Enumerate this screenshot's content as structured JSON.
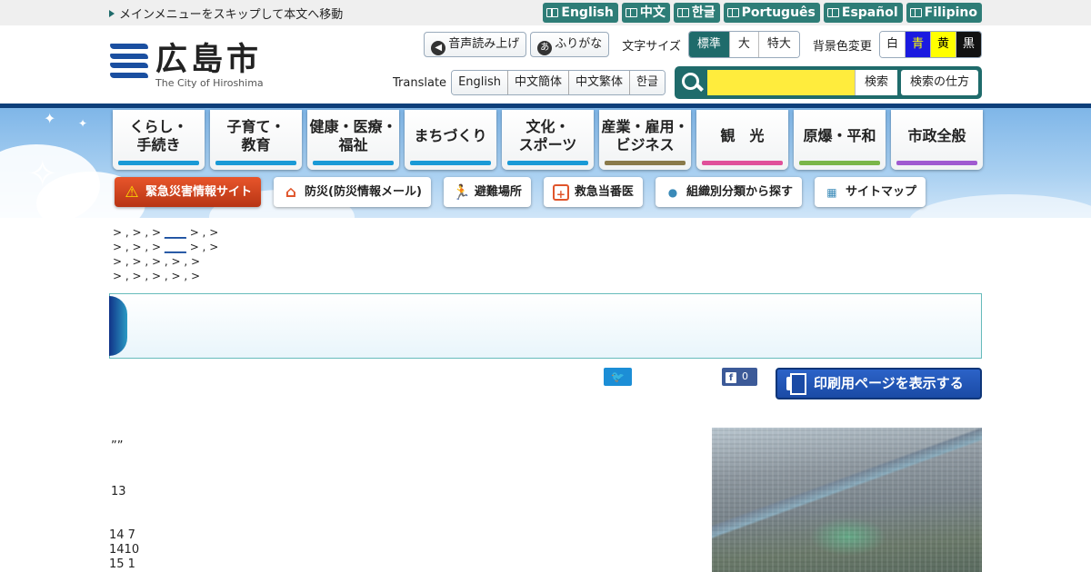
{
  "topbar": {
    "skip_link": "メインメニューをスキップして本文へ移動",
    "languages": [
      "English",
      "中文",
      "한글",
      "Português",
      "Español",
      "Filipino"
    ]
  },
  "logo": {
    "jp": "広島市",
    "en": "The City of Hiroshima"
  },
  "tools": {
    "voice_label": "音声読み上げ",
    "furigana_label": "ふりがな",
    "furigana_icon_glyph": "あ",
    "fontsize_label": "文字サイズ",
    "fontsize_options": [
      "標準",
      "大",
      "特大"
    ],
    "fontsize_selected": "標準",
    "bgcolor_label": "背景色変更",
    "bgcolor_options": [
      "白",
      "青",
      "黄",
      "黒"
    ],
    "translate_label": "Translate",
    "translate_options": [
      "English",
      "中文簡体",
      "中文繁体",
      "한글"
    ],
    "search_button": "検索",
    "search_help_button": "検索の仕方"
  },
  "nav": [
    {
      "label": "くらし・\n手続き",
      "color": "#1a9ad6"
    },
    {
      "label": "子育て・\n教育",
      "color": "#1a9ad6"
    },
    {
      "label": "健康・医療・\n福祉",
      "color": "#1a9ad6"
    },
    {
      "label": "まちづくり",
      "color": "#1a9ad6"
    },
    {
      "label": "文化・\nスポーツ",
      "color": "#1a9ad6"
    },
    {
      "label": "産業・雇用・\nビジネス",
      "color": "#8a7a4a"
    },
    {
      "label": "観　光",
      "color": "#e0509a"
    },
    {
      "label": "原爆・平和",
      "color": "#7ab648"
    },
    {
      "label": "市政全般",
      "color": "#a05ad0"
    }
  ],
  "quick": {
    "emergency": "緊急災害情報サイト",
    "bousai": "防災(防災情報メール)",
    "hinan": "避難場所",
    "kyuukyuu": "救急当番医",
    "soshiki": "組織別分類から探す",
    "sitemap": "サイトマップ"
  },
  "breadcrumbs": {
    "line1": "> , > , > ",
    "line1_link": "____",
    "line1_tail": " > , >",
    "line2": "> , > , > ",
    "line2_link": "____",
    "line2_tail": " > , >",
    "line3": "> , > , > , > , >",
    "line4": "> , > , > , > , >"
  },
  "share": {
    "tweet_glyph": "🐦",
    "like_count": "0",
    "print_label": "印刷用ページを表示する"
  },
  "body": {
    "line1": "””",
    "line2": "13",
    "line3": "14 7",
    "line4": "1410",
    "line5": "15 1"
  }
}
